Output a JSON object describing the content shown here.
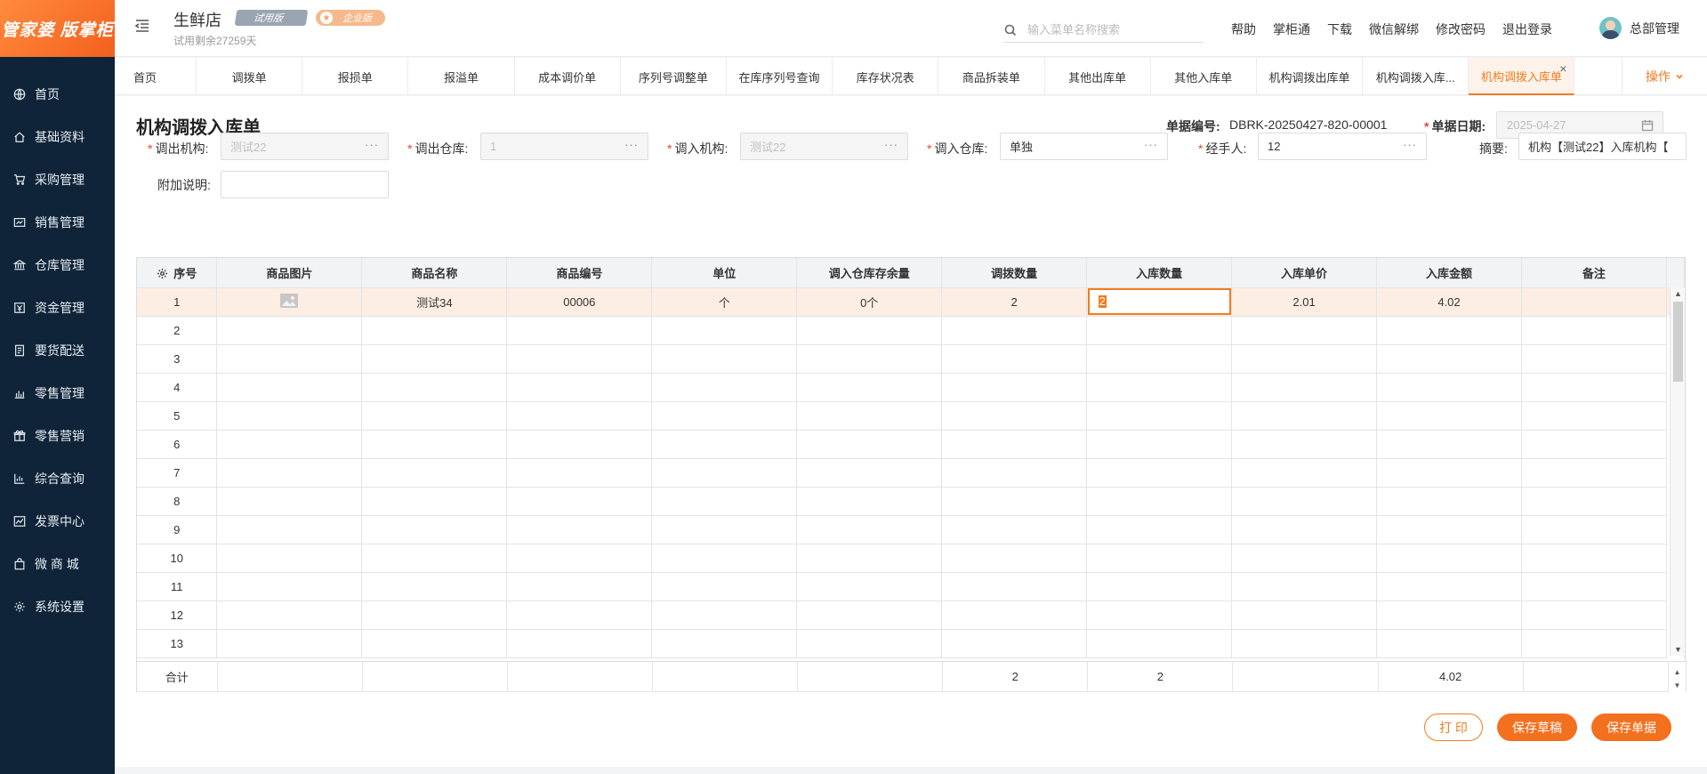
{
  "logo": {
    "text": "管家婆 版掌柜"
  },
  "sidebar": {
    "items": [
      {
        "label": "首页",
        "icon": "globe-icon"
      },
      {
        "label": "基础资料",
        "icon": "home-icon"
      },
      {
        "label": "采购管理",
        "icon": "cart-icon"
      },
      {
        "label": "销售管理",
        "icon": "chart-box-icon"
      },
      {
        "label": "仓库管理",
        "icon": "bank-icon"
      },
      {
        "label": "资金管理",
        "icon": "money-icon"
      },
      {
        "label": "要货配送",
        "icon": "document-icon"
      },
      {
        "label": "零售管理",
        "icon": "bar-chart-icon"
      },
      {
        "label": "零售营销",
        "icon": "gift-icon"
      },
      {
        "label": "综合查询",
        "icon": "stats-icon"
      },
      {
        "label": "发票中心",
        "icon": "trend-icon"
      },
      {
        "label": "微 商 城",
        "icon": "bag-icon"
      },
      {
        "label": "系统设置",
        "icon": "gear-icon"
      }
    ]
  },
  "header": {
    "store_name": "生鲜店",
    "badge_trial": "试用版",
    "badge_enterprise": "企业版",
    "trial_remaining": "试用剩余27259天",
    "search_placeholder": "输入菜单名称搜索",
    "links": [
      "帮助",
      "掌柜通",
      "下载",
      "微信解绑",
      "修改密码",
      "退出登录"
    ],
    "user_name": "总部管理"
  },
  "tabs": {
    "items": [
      "首页",
      "调拨单",
      "报损单",
      "报溢单",
      "成本调价单",
      "序列号调整单",
      "在库序列号查询",
      "库存状况表",
      "商品拆装单",
      "其他出库单",
      "其他入库单",
      "机构调拨出库单",
      "机构调拨入库...",
      "机构调拨入库单"
    ],
    "active_index": 13,
    "close_symbol": "×",
    "ops_label": "操作"
  },
  "form": {
    "title": "机构调拨入库单",
    "doc_no_label": "单据编号:",
    "doc_no": "DBRK-20250427-820-00001",
    "doc_date_label": "单据日期:",
    "doc_date": "2025-04-27",
    "out_org_label": "调出机构:",
    "out_org_value": "测试22",
    "out_wh_label": "调出仓库:",
    "out_wh_value": "1",
    "in_org_label": "调入机构:",
    "in_org_value": "测试22",
    "in_wh_label": "调入仓库:",
    "in_wh_value": "单独",
    "handler_label": "经手人:",
    "handler_value": "12",
    "summary_label": "摘要:",
    "summary_value": "机构【测试22】入库机构【",
    "note_label": "附加说明:",
    "note_value": "",
    "dots": "···",
    "required_mark": "*"
  },
  "table": {
    "columns": [
      "序号",
      "商品图片",
      "商品名称",
      "商品编号",
      "单位",
      "调入仓库存余量",
      "调拨数量",
      "入库数量",
      "入库单价",
      "入库金额",
      "备注"
    ],
    "rows": [
      {
        "seq": "1",
        "image": "image-placeholder-icon",
        "name": "测试34",
        "code": "00006",
        "unit": "个",
        "stock": "0个",
        "transfer_qty": "2",
        "in_qty": "2",
        "price": "2.01",
        "amount": "4.02",
        "remark": ""
      },
      {
        "seq": "2"
      },
      {
        "seq": "3"
      },
      {
        "seq": "4"
      },
      {
        "seq": "5"
      },
      {
        "seq": "6"
      },
      {
        "seq": "7"
      },
      {
        "seq": "8"
      },
      {
        "seq": "9"
      },
      {
        "seq": "10"
      },
      {
        "seq": "11"
      },
      {
        "seq": "12"
      },
      {
        "seq": "13"
      }
    ],
    "totals": {
      "label": "合计",
      "transfer_qty": "2",
      "in_qty": "2",
      "amount": "4.02"
    }
  },
  "buttons": {
    "print": "打 印",
    "save_draft": "保存草稿",
    "save_doc": "保存单据"
  },
  "colors": {
    "accent": "#f37b20",
    "sidebar_bg": "#0f2438",
    "selected_row": "#fdeee4"
  }
}
